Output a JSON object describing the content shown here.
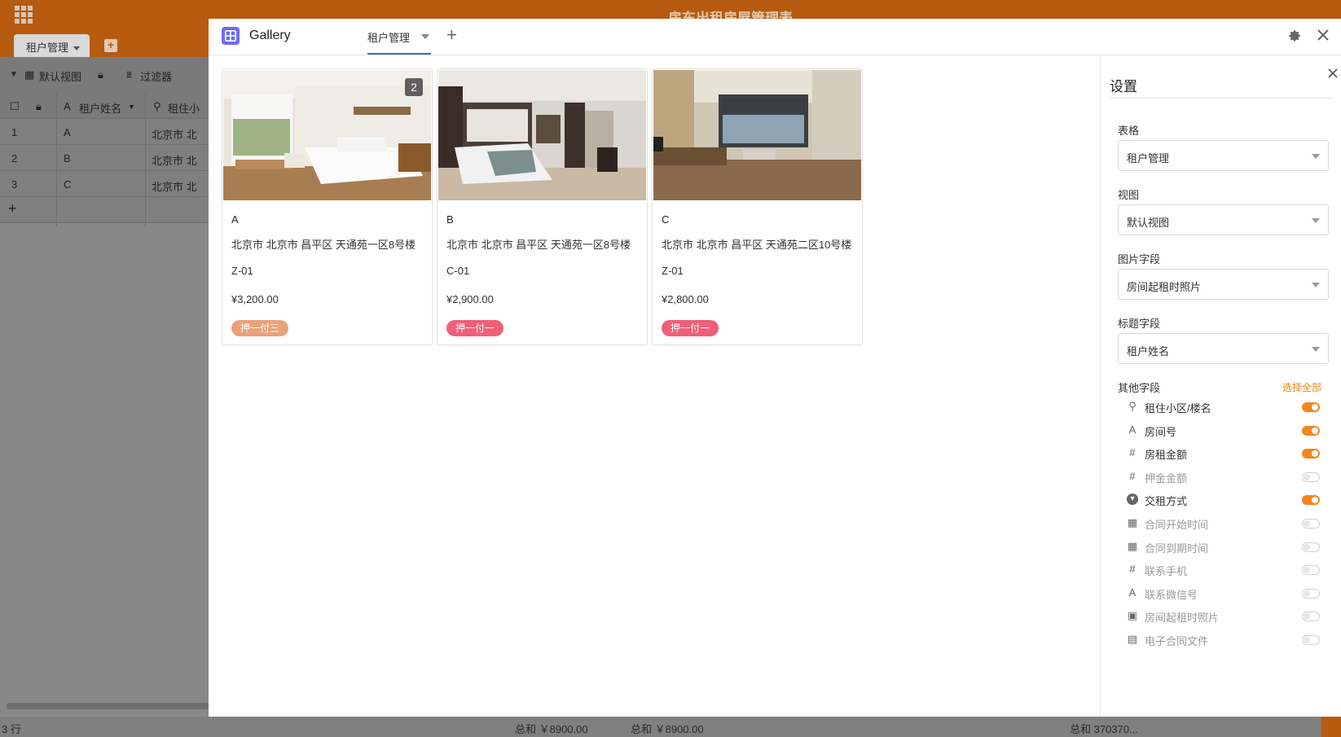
{
  "background": {
    "doc_title": "房东出租房屋管理表",
    "table_tab": "租户管理",
    "toolbar": {
      "view": "默认视图",
      "filter": "过滤器"
    },
    "columns": [
      "租户姓名",
      "租住小"
    ],
    "rows": [
      {
        "index": "1",
        "name": "A",
        "addr": "北京市 北"
      },
      {
        "index": "2",
        "name": "B",
        "addr": "北京市 北"
      },
      {
        "index": "3",
        "name": "C",
        "addr": "北京市 北"
      }
    ],
    "add_row": "+",
    "status": {
      "row_count": "3 行",
      "sum1": "总和 ￥8900.00",
      "sum2": "总和 ￥8900.00",
      "sum3": "总和 370370..."
    }
  },
  "modal": {
    "app_title": "Gallery",
    "view_tab": "租户管理",
    "add_view": "+"
  },
  "cards": [
    {
      "title": "A",
      "address": "北京市 北京市 昌平区 天通苑一区8号楼",
      "room": "Z-01",
      "rent": "¥3,200.00",
      "payment": "押一付三",
      "payment_color": "#e9a27a",
      "image_count": "2"
    },
    {
      "title": "B",
      "address": "北京市 北京市 昌平区 天通苑一区8号楼",
      "room": "C-01",
      "rent": "¥2,900.00",
      "payment": "押一付一",
      "payment_color": "#ef5f78",
      "image_count": ""
    },
    {
      "title": "C",
      "address": "北京市 北京市 昌平区 天通苑二区10号楼",
      "room": "Z-01",
      "rent": "¥2,800.00",
      "payment": "押一付一",
      "payment_color": "#ef5f78",
      "image_count": ""
    }
  ],
  "settings": {
    "title": "设置",
    "table_label": "表格",
    "table_value": "租户管理",
    "view_label": "视图",
    "view_value": "默认视图",
    "image_field_label": "图片字段",
    "image_field_value": "房间起租时照片",
    "title_field_label": "标题字段",
    "title_field_value": "租户姓名",
    "other_fields_label": "其他字段",
    "select_all": "选择全部",
    "fields": [
      {
        "label": "租住小区/楼名",
        "icon": "location-icon",
        "glyph": "⚲",
        "enabled": true
      },
      {
        "label": "房间号",
        "icon": "text-icon",
        "glyph": "A",
        "enabled": true
      },
      {
        "label": "房租金额",
        "icon": "number-icon",
        "glyph": "#",
        "enabled": true
      },
      {
        "label": "押金金额",
        "icon": "number-icon",
        "glyph": "#",
        "enabled": false
      },
      {
        "label": "交租方式",
        "icon": "single-select-icon",
        "glyph": "▾",
        "enabled": true
      },
      {
        "label": "合同开始时间",
        "icon": "calendar-icon",
        "glyph": "▦",
        "enabled": false
      },
      {
        "label": "合同到期时间",
        "icon": "calendar-icon",
        "glyph": "▦",
        "enabled": false
      },
      {
        "label": "联系手机",
        "icon": "number-icon",
        "glyph": "#",
        "enabled": false
      },
      {
        "label": "联系微信号",
        "icon": "text-icon",
        "glyph": "A",
        "enabled": false
      },
      {
        "label": "房间起租时照片",
        "icon": "image-icon",
        "glyph": "▣",
        "enabled": false
      },
      {
        "label": "电子合同文件",
        "icon": "file-icon",
        "glyph": "▤",
        "enabled": false
      }
    ]
  },
  "colors": {
    "accent": "#f5851f",
    "brand": "#b65b10",
    "tab_underline": "#2d6cdf",
    "gallery_icon": "#6e6cf0"
  }
}
